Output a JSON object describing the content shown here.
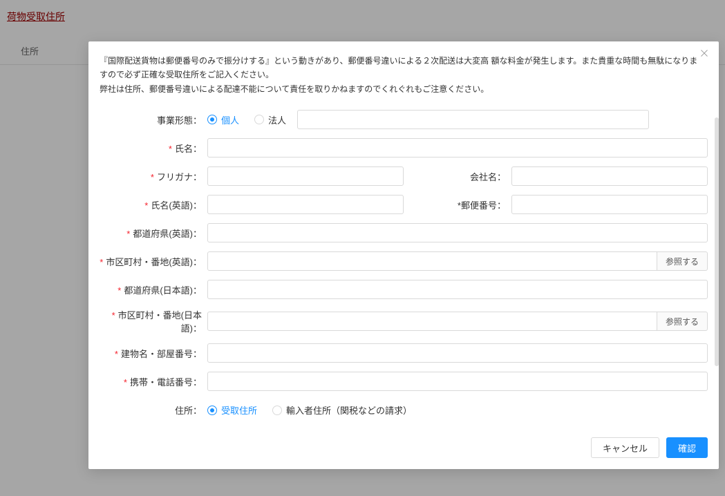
{
  "page": {
    "title": "荷物受取住所",
    "tab": "住所"
  },
  "modal": {
    "notice_line1": "『国際配送貨物は郵便番号のみで振分けする』という動きがあり、郵便番号違いによる２次配送は大変高 額な料金が発生します。また貴重な時間も無駄になりますので必ず正確な受取住所をご記入ください。",
    "notice_line2": "弊社は住所、郵便番号違いによる配達不能について責任を取りかねますのでくれぐれもご注意ください。",
    "labels": {
      "business_type": "事業形態：",
      "name": "氏名：",
      "furigana": "フリガナ：",
      "company": "会社名：",
      "name_en": "氏名(英語)：",
      "postal": "郵便番号：",
      "pref_en": "都道府県(英語)：",
      "city_en": "市区町村・番地(英語)：",
      "pref_ja": "都道府県(日本語)：",
      "city_ja": "市区町村・番地(日本語)：",
      "building": "建物名・部屋番号：",
      "phone": "携帯・電話番号：",
      "address_type": "住所："
    },
    "radios": {
      "business_individual": "個人",
      "business_corporate": "法人",
      "addr_receive": "受取住所",
      "addr_import": "輸入者住所（関税などの請求）"
    },
    "buttons": {
      "browse": "参照する",
      "cancel": "キャンセル",
      "confirm": "確認"
    }
  }
}
